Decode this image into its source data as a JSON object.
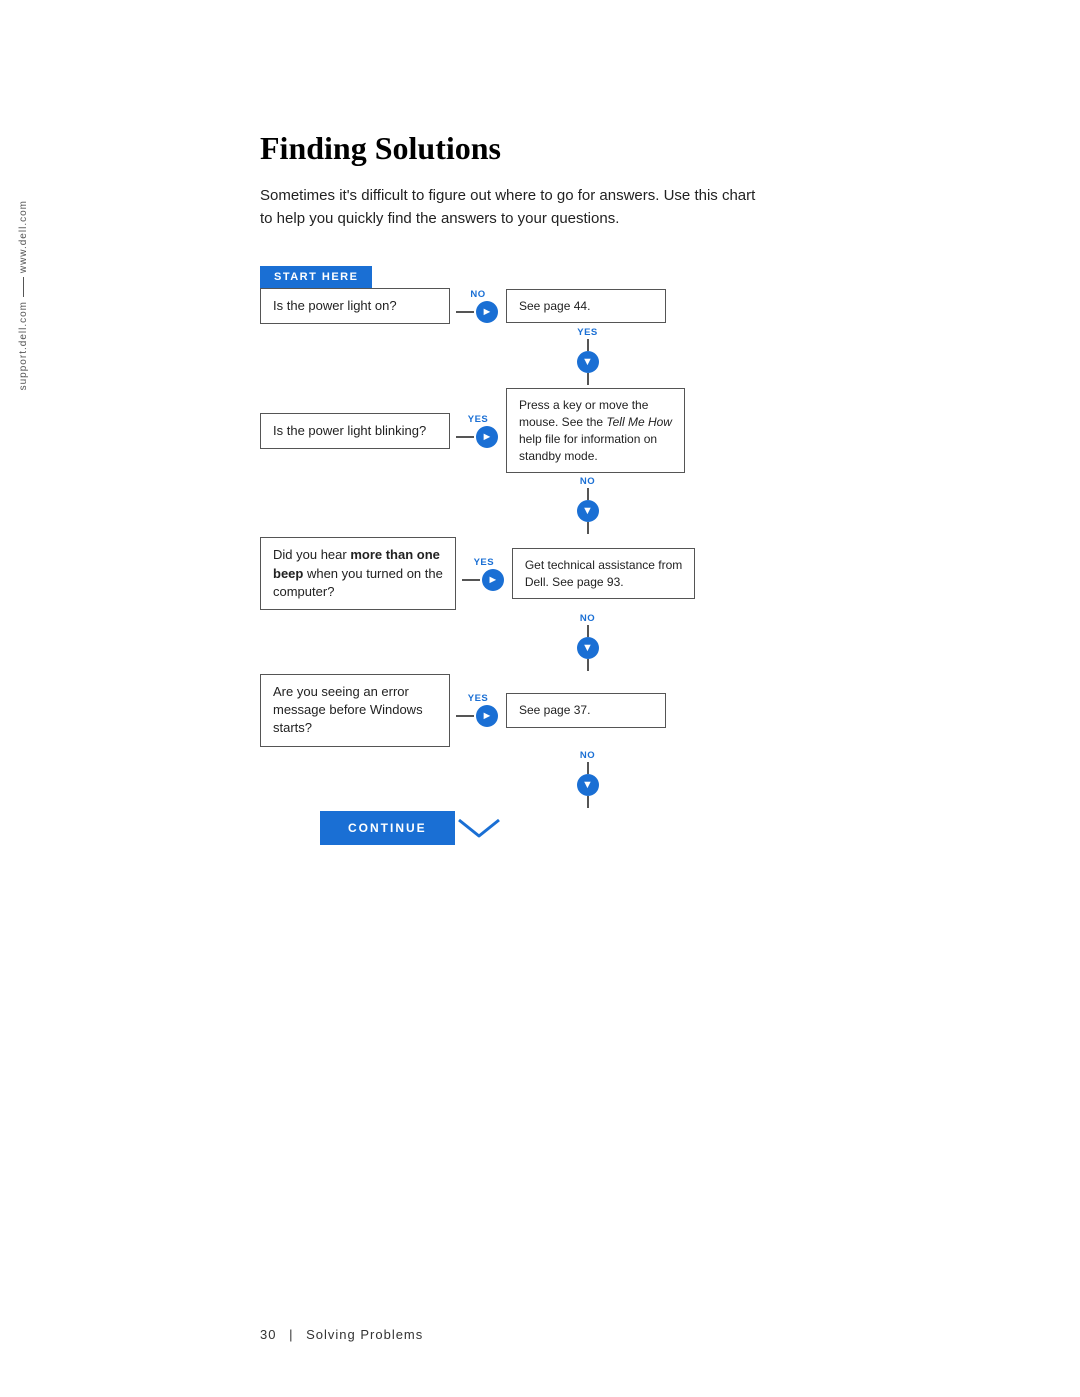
{
  "sidebar": {
    "url1": "www.dell.com",
    "url2": "support.dell.com"
  },
  "page": {
    "title": "Finding Solutions",
    "subtitle_line1": "Sometimes it's difficult to figure out where to go for answers. Use this chart",
    "subtitle_line2": "to help you quickly find the answers to your questions.",
    "start_here_label": "START HERE",
    "q1": "Is the power light on?",
    "q1_no_answer": "See page 44.",
    "q1_no_label": "NO",
    "q1_yes_label": "YES",
    "q2": "Is the power light blinking?",
    "q2_yes_label": "YES",
    "q2_yes_answer_line1": "Press a key or move the",
    "q2_yes_answer_line2": "mouse. See the ",
    "q2_yes_answer_italic": "Tell Me How",
    "q2_yes_answer_line3": "help file for information on",
    "q2_yes_answer_line4": "standby mode.",
    "q2_no_label": "NO",
    "q3_line1": "Did you hear ",
    "q3_bold": "more than one",
    "q3_line2": "beep",
    "q3_line2b": " when you turned on the",
    "q3_line3": "computer?",
    "q3_yes_label": "YES",
    "q3_yes_answer_line1": "Get technical assistance from",
    "q3_yes_answer_line2": "Dell. See page 93.",
    "q3_no_label": "NO",
    "q4_line1": "Are you seeing an error",
    "q4_line2": "message before Windows",
    "q4_line3": "starts?",
    "q4_yes_label": "YES",
    "q4_yes_answer": "See page 37.",
    "q4_no_label": "NO",
    "continue_label": "CONTINUE",
    "footer_page": "30",
    "footer_text": "Solving Problems"
  }
}
